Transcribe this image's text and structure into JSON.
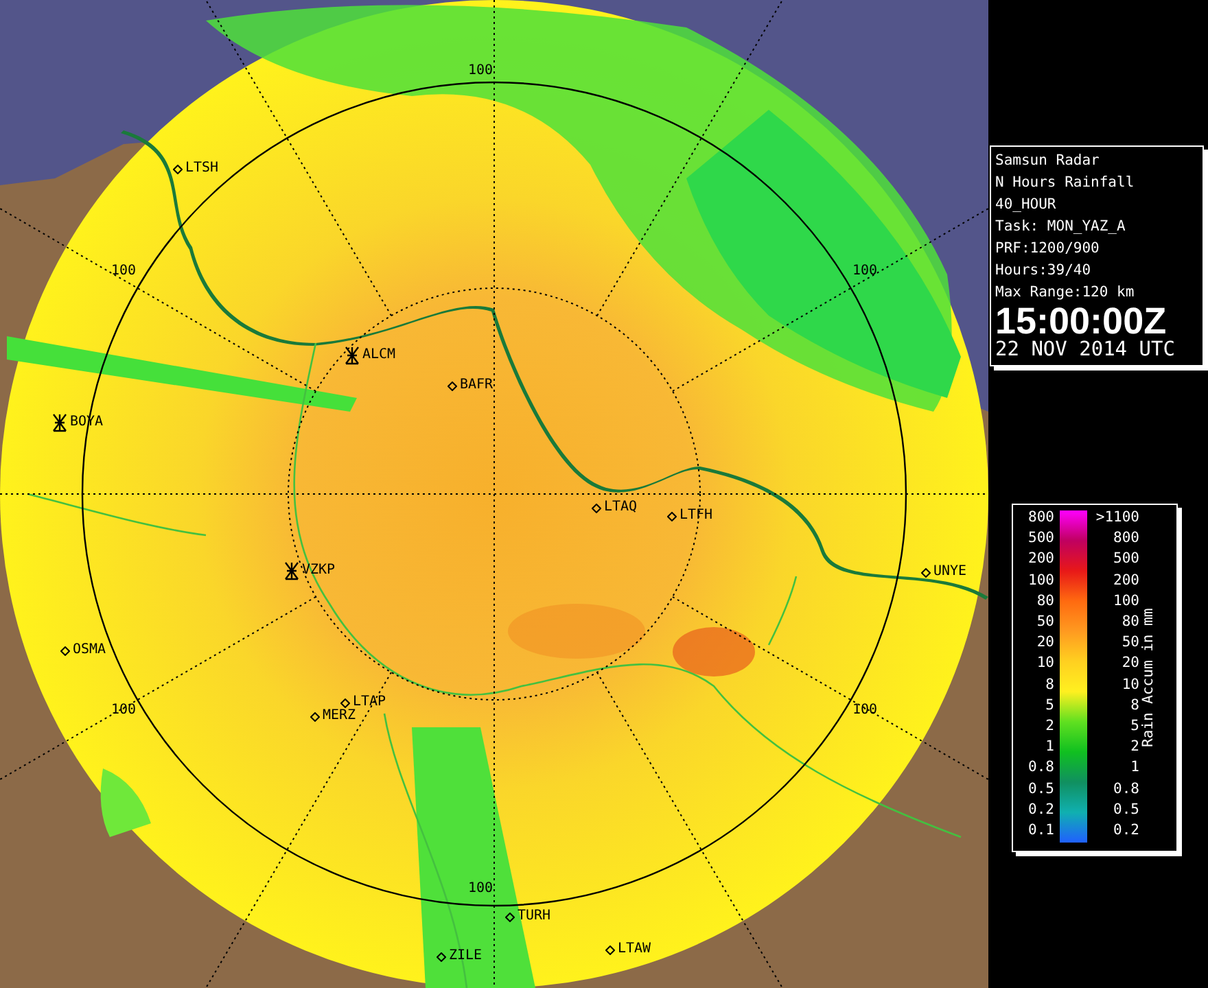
{
  "map": {
    "range_labels": [
      {
        "text": "100"
      },
      {
        "text": "100"
      },
      {
        "text": "100"
      },
      {
        "text": "100"
      },
      {
        "text": "100"
      },
      {
        "text": "100"
      }
    ],
    "sites": [
      {
        "name": "LTSH",
        "kind": "point"
      },
      {
        "name": "ALCM",
        "kind": "radar"
      },
      {
        "name": "BAFR",
        "kind": "point"
      },
      {
        "name": "BOYA",
        "kind": "radar"
      },
      {
        "name": "LTAQ",
        "kind": "point"
      },
      {
        "name": "LTFH",
        "kind": "point"
      },
      {
        "name": "VZKP",
        "kind": "radar"
      },
      {
        "name": "UNYE",
        "kind": "point"
      },
      {
        "name": "OSMA",
        "kind": "point"
      },
      {
        "name": "LTAP",
        "kind": "point"
      },
      {
        "name": "MERZ",
        "kind": "point"
      },
      {
        "name": "TURH",
        "kind": "point"
      },
      {
        "name": "ZILE",
        "kind": "point"
      },
      {
        "name": "LTAW",
        "kind": "point"
      }
    ]
  },
  "info": {
    "lines": [
      "Samsun Radar",
      "N Hours Rainfall",
      "40_HOUR",
      "Task: MON_YAZ_A",
      "PRF:1200/900",
      "Hours:39/40",
      "Max Range:120 km"
    ],
    "time": "15:00:00Z",
    "date": "22 NOV 2014 UTC"
  },
  "legend": {
    "title": "Rain Accum in mm",
    "rows": [
      {
        "low": "800",
        "high": ">1100"
      },
      {
        "low": "500",
        "high": "800"
      },
      {
        "low": "200",
        "high": "500"
      },
      {
        "low": "100",
        "high": "200"
      },
      {
        "low": "80",
        "high": "100"
      },
      {
        "low": "50",
        "high": "80"
      },
      {
        "low": "20",
        "high": "50"
      },
      {
        "low": "10",
        "high": "20"
      },
      {
        "low": "8",
        "high": "10"
      },
      {
        "low": "5",
        "high": "8"
      },
      {
        "low": "2",
        "high": "5"
      },
      {
        "low": "1",
        "high": "2"
      },
      {
        "low": "0.8",
        "high": "1"
      },
      {
        "low": "0.5",
        "high": "0.8"
      },
      {
        "low": "0.2",
        "high": "0.5"
      },
      {
        "low": "0.1",
        "high": "0.2"
      }
    ]
  }
}
